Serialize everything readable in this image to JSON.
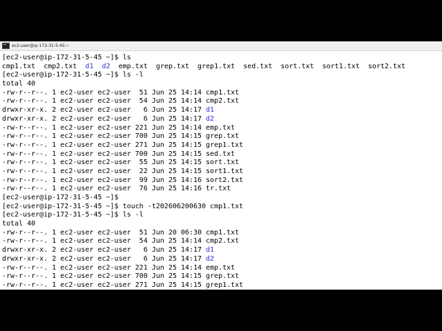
{
  "window": {
    "title": "ec2-user@ip-172-31-5-45:~"
  },
  "colors": {
    "terminal_background": "#ffffff",
    "text": "#000000",
    "directory": "#2d2dd8",
    "letterbox": "#000000"
  },
  "terminal": {
    "lines": [
      {
        "segments": [
          {
            "text": "[ec2-user@ip-172-31-5-45 ~]$ ls"
          }
        ]
      },
      {
        "segments": [
          {
            "text": "cmp1.txt  cmp2.txt  "
          },
          {
            "text": "d1",
            "dir": true
          },
          {
            "text": "  "
          },
          {
            "text": "d2",
            "dir": true
          },
          {
            "text": "  emp.txt  grep.txt  grep1.txt  sed.txt  sort.txt  sort1.txt  sort2.txt"
          }
        ]
      },
      {
        "segments": [
          {
            "text": "[ec2-user@ip-172-31-5-45 ~]$ ls -l"
          }
        ]
      },
      {
        "segments": [
          {
            "text": "total 40"
          }
        ]
      },
      {
        "segments": [
          {
            "text": "-rw-r--r--. 1 ec2-user ec2-user  51 Jun 25 14:14 cmp1.txt"
          }
        ]
      },
      {
        "segments": [
          {
            "text": "-rw-r--r--. 1 ec2-user ec2-user  54 Jun 25 14:14 cmp2.txt"
          }
        ]
      },
      {
        "segments": [
          {
            "text": "drwxr-xr-x. 2 ec2-user ec2-user   6 Jun 25 14:17 "
          },
          {
            "text": "d1",
            "dir": true
          }
        ]
      },
      {
        "segments": [
          {
            "text": "drwxr-xr-x. 2 ec2-user ec2-user   6 Jun 25 14:17 "
          },
          {
            "text": "d2",
            "dir": true
          }
        ]
      },
      {
        "segments": [
          {
            "text": "-rw-r--r--. 1 ec2-user ec2-user 221 Jun 25 14:14 emp.txt"
          }
        ]
      },
      {
        "segments": [
          {
            "text": "-rw-r--r--. 1 ec2-user ec2-user 700 Jun 25 14:15 grep.txt"
          }
        ]
      },
      {
        "segments": [
          {
            "text": "-rw-r--r--. 1 ec2-user ec2-user 271 Jun 25 14:15 grep1.txt"
          }
        ]
      },
      {
        "segments": [
          {
            "text": "-rw-r--r--. 1 ec2-user ec2-user 700 Jun 25 14:15 sed.txt"
          }
        ]
      },
      {
        "segments": [
          {
            "text": "-rw-r--r--. 1 ec2-user ec2-user  55 Jun 25 14:15 sort.txt"
          }
        ]
      },
      {
        "segments": [
          {
            "text": "-rw-r--r--. 1 ec2-user ec2-user  22 Jun 25 14:15 sort1.txt"
          }
        ]
      },
      {
        "segments": [
          {
            "text": "-rw-r--r--. 1 ec2-user ec2-user  99 Jun 25 14:16 sort2.txt"
          }
        ]
      },
      {
        "segments": [
          {
            "text": "-rw-r--r--. 1 ec2-user ec2-user  76 Jun 25 14:16 tr.txt"
          }
        ]
      },
      {
        "segments": [
          {
            "text": "[ec2-user@ip-172-31-5-45 ~]$"
          }
        ]
      },
      {
        "segments": [
          {
            "text": "[ec2-user@ip-172-31-5-45 ~]$ touch -t202606200630 cmp1.txt"
          }
        ]
      },
      {
        "segments": [
          {
            "text": "[ec2-user@ip-172-31-5-45 ~]$ ls -l"
          }
        ]
      },
      {
        "segments": [
          {
            "text": "total 40"
          }
        ]
      },
      {
        "segments": [
          {
            "text": "-rw-r--r--. 1 ec2-user ec2-user  51 Jun 20 06:30 cmp1.txt"
          }
        ]
      },
      {
        "segments": [
          {
            "text": "-rw-r--r--. 1 ec2-user ec2-user  54 Jun 25 14:14 cmp2.txt"
          }
        ]
      },
      {
        "segments": [
          {
            "text": "drwxr-xr-x. 2 ec2-user ec2-user   6 Jun 25 14:17 "
          },
          {
            "text": "d1",
            "dir": true
          }
        ]
      },
      {
        "segments": [
          {
            "text": "drwxr-xr-x. 2 ec2-user ec2-user   6 Jun 25 14:17 "
          },
          {
            "text": "d2",
            "dir": true
          }
        ]
      },
      {
        "segments": [
          {
            "text": "-rw-r--r--. 1 ec2-user ec2-user 221 Jun 25 14:14 emp.txt"
          }
        ]
      },
      {
        "segments": [
          {
            "text": "-rw-r--r--. 1 ec2-user ec2-user 700 Jun 25 14:15 grep.txt"
          }
        ]
      },
      {
        "segments": [
          {
            "text": "-rw-r--r--. 1 ec2-user ec2-user 271 Jun 25 14:15 grep1.txt"
          }
        ]
      }
    ]
  }
}
